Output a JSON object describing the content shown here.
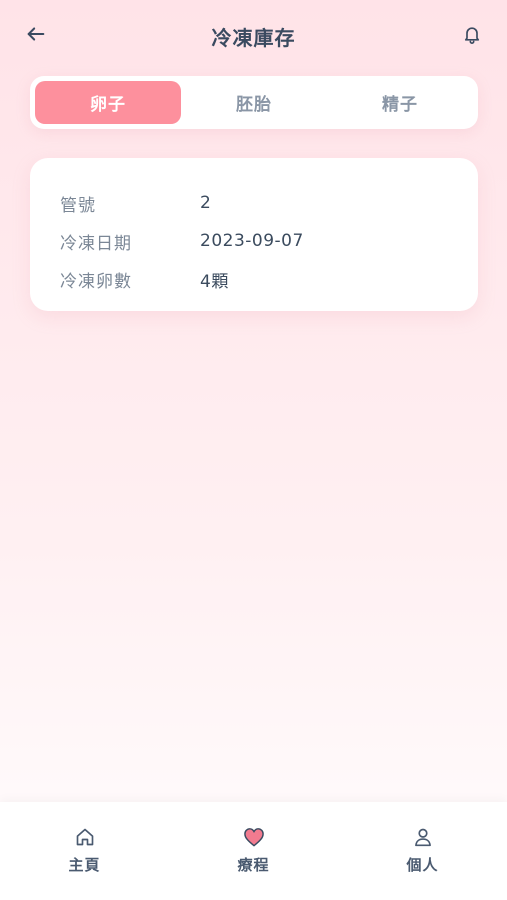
{
  "header": {
    "title": "冷凍庫存",
    "back_icon": "arrow-left-icon",
    "notification_icon": "bell-icon"
  },
  "tabs": [
    {
      "label": "卵子",
      "active": true
    },
    {
      "label": "胚胎",
      "active": false
    },
    {
      "label": "精子",
      "active": false
    }
  ],
  "record": {
    "rows": [
      {
        "label": "管號",
        "value": "2"
      },
      {
        "label": "冷凍日期",
        "value": "2023-09-07"
      },
      {
        "label": "冷凍卵數",
        "value": "4顆"
      }
    ]
  },
  "bottom_nav": {
    "items": [
      {
        "label": "主頁",
        "icon": "home-icon"
      },
      {
        "label": "療程",
        "icon": "heart-icon"
      },
      {
        "label": "個人",
        "icon": "user-icon"
      }
    ]
  },
  "colors": {
    "accent": "#fd909d",
    "text_primary": "#3a4a60",
    "text_muted": "#8a96a6"
  }
}
